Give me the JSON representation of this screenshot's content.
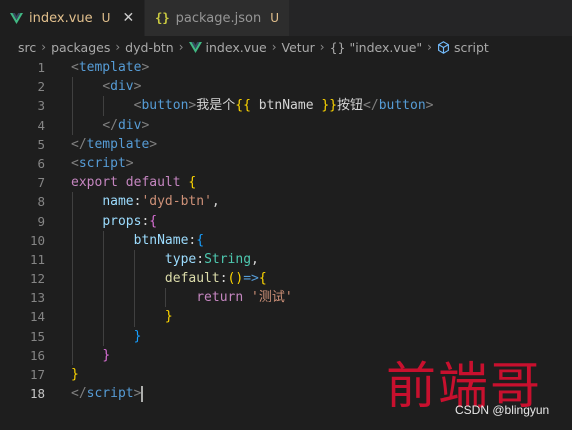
{
  "tabs": [
    {
      "label": "index.vue",
      "modified": "U",
      "active": true,
      "icon": "vue-icon"
    },
    {
      "label": "package.json",
      "modified": "U",
      "active": false,
      "icon": "json-icon",
      "icon_glyph": "{}"
    }
  ],
  "tab_close": "✕",
  "breadcrumb": {
    "items": [
      "src",
      "packages",
      "dyd-btn",
      "index.vue",
      "Vetur",
      "{} \"index.vue\"",
      "script"
    ],
    "separator": "›"
  },
  "editor": {
    "current_line": 18,
    "line_numbers": [
      "1",
      "2",
      "3",
      "4",
      "5",
      "6",
      "7",
      "8",
      "9",
      "10",
      "11",
      "12",
      "13",
      "14",
      "15",
      "16",
      "17",
      "18"
    ],
    "lines": [
      [
        {
          "t": "<",
          "c": "punc"
        },
        {
          "t": "template",
          "c": "tag"
        },
        {
          "t": ">",
          "c": "punc"
        }
      ],
      [
        {
          "t": "    ",
          "c": "white"
        },
        {
          "t": "<",
          "c": "punc"
        },
        {
          "t": "div",
          "c": "tag"
        },
        {
          "t": ">",
          "c": "punc"
        }
      ],
      [
        {
          "t": "        ",
          "c": "white"
        },
        {
          "t": "<",
          "c": "punc"
        },
        {
          "t": "button",
          "c": "tag"
        },
        {
          "t": ">",
          "c": "punc"
        },
        {
          "t": "我是个",
          "c": "txt"
        },
        {
          "t": "{{",
          "c": "b1"
        },
        {
          "t": " btnName ",
          "c": "txt"
        },
        {
          "t": "}}",
          "c": "b1"
        },
        {
          "t": "按钮",
          "c": "txt"
        },
        {
          "t": "</",
          "c": "punc"
        },
        {
          "t": "button",
          "c": "tag"
        },
        {
          "t": ">",
          "c": "punc"
        }
      ],
      [
        {
          "t": "    ",
          "c": "white"
        },
        {
          "t": "</",
          "c": "punc"
        },
        {
          "t": "div",
          "c": "tag"
        },
        {
          "t": ">",
          "c": "punc"
        }
      ],
      [
        {
          "t": "</",
          "c": "punc"
        },
        {
          "t": "template",
          "c": "tag"
        },
        {
          "t": ">",
          "c": "punc"
        }
      ],
      [
        {
          "t": "<",
          "c": "punc"
        },
        {
          "t": "script",
          "c": "tag"
        },
        {
          "t": ">",
          "c": "punc"
        }
      ],
      [
        {
          "t": "export",
          "c": "kw"
        },
        {
          "t": " ",
          "c": "white"
        },
        {
          "t": "default",
          "c": "kw"
        },
        {
          "t": " ",
          "c": "white"
        },
        {
          "t": "{",
          "c": "b1"
        }
      ],
      [
        {
          "t": "    ",
          "c": "white"
        },
        {
          "t": "name",
          "c": "prop"
        },
        {
          "t": ":",
          "c": "white"
        },
        {
          "t": "'dyd-btn'",
          "c": "str"
        },
        {
          "t": ",",
          "c": "white"
        }
      ],
      [
        {
          "t": "    ",
          "c": "white"
        },
        {
          "t": "props",
          "c": "prop"
        },
        {
          "t": ":",
          "c": "white"
        },
        {
          "t": "{",
          "c": "b2"
        }
      ],
      [
        {
          "t": "        ",
          "c": "white"
        },
        {
          "t": "btnName",
          "c": "prop"
        },
        {
          "t": ":",
          "c": "white"
        },
        {
          "t": "{",
          "c": "b3"
        }
      ],
      [
        {
          "t": "            ",
          "c": "white"
        },
        {
          "t": "type",
          "c": "prop"
        },
        {
          "t": ":",
          "c": "white"
        },
        {
          "t": "String",
          "c": "type"
        },
        {
          "t": ",",
          "c": "white"
        }
      ],
      [
        {
          "t": "            ",
          "c": "white"
        },
        {
          "t": "default",
          "c": "fn"
        },
        {
          "t": ":",
          "c": "white"
        },
        {
          "t": "()",
          "c": "b1"
        },
        {
          "t": "=>",
          "c": "kw2"
        },
        {
          "t": "{",
          "c": "b1"
        }
      ],
      [
        {
          "t": "                ",
          "c": "white"
        },
        {
          "t": "return",
          "c": "kw"
        },
        {
          "t": " ",
          "c": "white"
        },
        {
          "t": "'测试'",
          "c": "str"
        }
      ],
      [
        {
          "t": "            ",
          "c": "white"
        },
        {
          "t": "}",
          "c": "b1"
        }
      ],
      [
        {
          "t": "        ",
          "c": "white"
        },
        {
          "t": "}",
          "c": "b3"
        }
      ],
      [
        {
          "t": "    ",
          "c": "white"
        },
        {
          "t": "}",
          "c": "b2"
        }
      ],
      [
        {
          "t": "}",
          "c": "b1"
        }
      ],
      [
        {
          "t": "</",
          "c": "punc"
        },
        {
          "t": "script",
          "c": "tag"
        },
        {
          "t": ">",
          "c": "punc"
        }
      ]
    ]
  },
  "watermark": {
    "logo_text": "前端哥",
    "credit": "CSDN @blingyun"
  },
  "colors": {
    "background": "#1e1e1e",
    "tag": "#569cd6",
    "keyword": "#c586c0",
    "property": "#9cdcfe",
    "string": "#ce9178",
    "modified": "#e2c08d",
    "vue_green": "#41b883"
  }
}
